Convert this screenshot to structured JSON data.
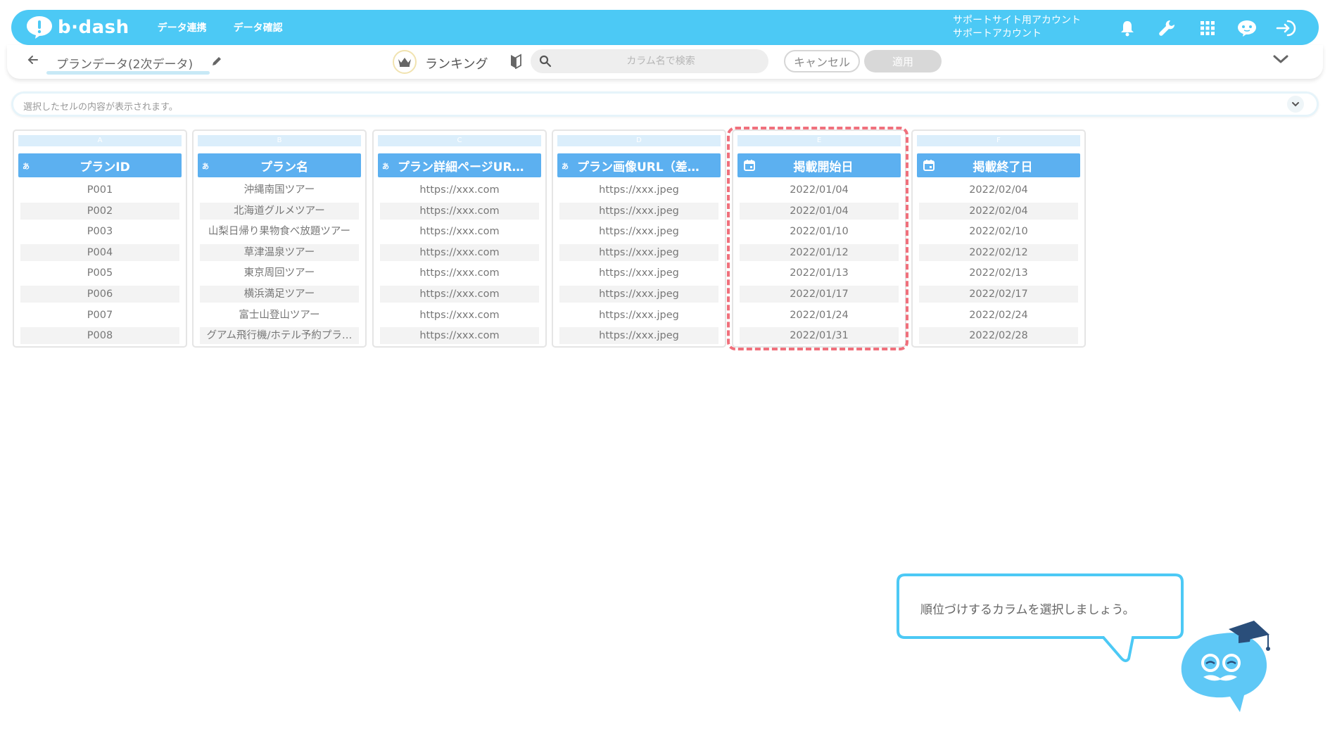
{
  "header": {
    "logo_text": "b·dash",
    "nav": [
      "データ連携",
      "データ確認"
    ],
    "account_line1": "サポートサイト用アカウント",
    "account_line2": "サポートアカウント",
    "icons": [
      "bell-icon",
      "wrench-icon",
      "apps-grid-icon",
      "assistant-icon",
      "logout-icon"
    ]
  },
  "toolbar": {
    "data_title": "プランデータ(2次データ)",
    "ranking_label": "ランキング",
    "search_placeholder": "カラム名で検索",
    "cancel_label": "キャンセル",
    "apply_label": "適用"
  },
  "cell_bar": {
    "placeholder": "選択したセルの内容が表示されます。"
  },
  "table": {
    "columns": [
      {
        "letter": "A",
        "type": "あ",
        "name": "プランID",
        "rows": [
          "P001",
          "P002",
          "P003",
          "P004",
          "P005",
          "P006",
          "P007",
          "P008"
        ]
      },
      {
        "letter": "B",
        "type": "あ",
        "name": "プラン名",
        "rows": [
          "沖縄南国ツアー",
          "北海道グルメツアー",
          "山梨日帰り果物食べ放題ツアー",
          "草津温泉ツアー",
          "東京周回ツアー",
          "横浜満足ツアー",
          "富士山登山ツアー",
          "グアム飛行機/ホテル予約プラ…"
        ]
      },
      {
        "letter": "C",
        "type": "あ",
        "name": "プラン詳細ページUR…",
        "rows": [
          "https://xxx.com",
          "https://xxx.com",
          "https://xxx.com",
          "https://xxx.com",
          "https://xxx.com",
          "https://xxx.com",
          "https://xxx.com",
          "https://xxx.com"
        ]
      },
      {
        "letter": "D",
        "type": "あ",
        "name": "プラン画像URL（差…",
        "rows": [
          "https://xxx.jpeg",
          "https://xxx.jpeg",
          "https://xxx.jpeg",
          "https://xxx.jpeg",
          "https://xxx.jpeg",
          "https://xxx.jpeg",
          "https://xxx.jpeg",
          "https://xxx.jpeg"
        ]
      },
      {
        "letter": "E",
        "type": "date",
        "name": "掲載開始日",
        "rows": [
          "2022/01/04",
          "2022/01/04",
          "2022/01/10",
          "2022/01/12",
          "2022/01/13",
          "2022/01/17",
          "2022/01/24",
          "2022/01/31"
        ]
      },
      {
        "letter": "F",
        "type": "date",
        "name": "掲載終了日",
        "rows": [
          "2022/02/04",
          "2022/02/04",
          "2022/02/10",
          "2022/02/12",
          "2022/02/13",
          "2022/02/17",
          "2022/02/24",
          "2022/02/28"
        ]
      }
    ]
  },
  "tooltip": {
    "text": "順位づけするカラムを選択しましょう。"
  },
  "colors": {
    "brand": "#4cc9f5",
    "column_header": "#5cb0f0",
    "highlight": "#f0707c"
  }
}
